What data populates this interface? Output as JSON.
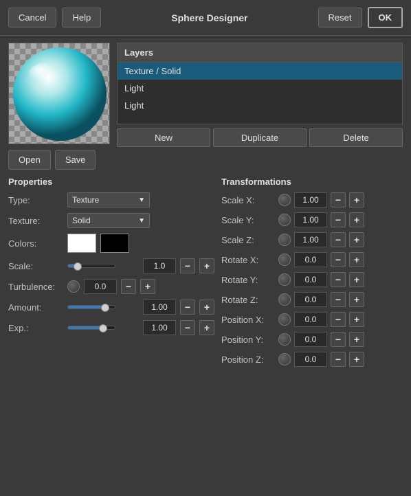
{
  "header": {
    "cancel_label": "Cancel",
    "help_label": "Help",
    "title": "Sphere Designer",
    "reset_label": "Reset",
    "ok_label": "OK"
  },
  "preview": {
    "open_label": "Open",
    "save_label": "Save"
  },
  "layers": {
    "title": "Layers",
    "items": [
      {
        "label": "Texture / Solid",
        "selected": true
      },
      {
        "label": "Light",
        "selected": false
      },
      {
        "label": "Light",
        "selected": false
      }
    ],
    "new_label": "New",
    "duplicate_label": "Duplicate",
    "delete_label": "Delete"
  },
  "properties": {
    "title": "Properties",
    "type_label": "Type:",
    "type_value": "Texture",
    "texture_label": "Texture:",
    "texture_value": "Solid",
    "colors_label": "Colors:",
    "scale_label": "Scale:",
    "scale_value": "1.0",
    "turbulence_label": "Turbulence:",
    "turbulence_value": "0.0",
    "amount_label": "Amount:",
    "amount_value": "1.00",
    "exp_label": "Exp.:",
    "exp_value": "1.00"
  },
  "transformations": {
    "title": "Transformations",
    "rows": [
      {
        "label": "Scale X:",
        "value": "1.00"
      },
      {
        "label": "Scale Y:",
        "value": "1.00"
      },
      {
        "label": "Scale Z:",
        "value": "1.00"
      },
      {
        "label": "Rotate X:",
        "value": "0.0"
      },
      {
        "label": "Rotate Y:",
        "value": "0.0"
      },
      {
        "label": "Rotate Z:",
        "value": "0.0"
      },
      {
        "label": "Position X:",
        "value": "0.0"
      },
      {
        "label": "Position Y:",
        "value": "0.0"
      },
      {
        "label": "Position Z:",
        "value": "0.0"
      }
    ]
  }
}
